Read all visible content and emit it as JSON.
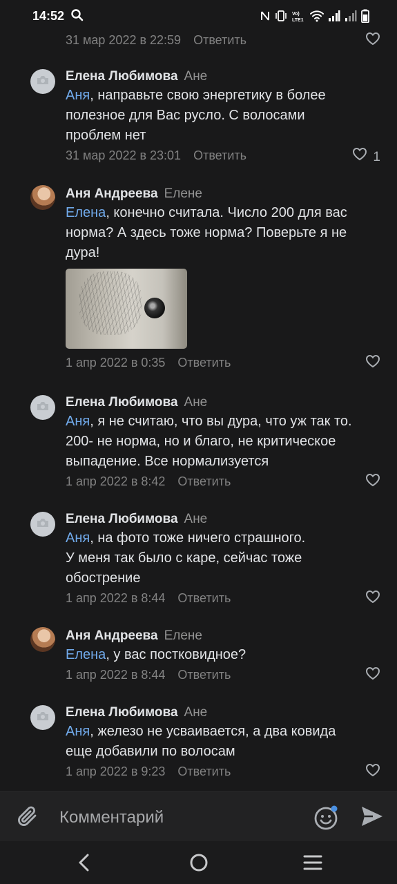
{
  "status_bar": {
    "time": "14:52",
    "icons": [
      "search-icon",
      "nfc-icon",
      "vibrate-icon",
      "volte-icon",
      "wifi-icon",
      "signal-icon",
      "signal-icon-2",
      "battery-icon"
    ]
  },
  "colors": {
    "background": "#19191a",
    "mention": "#71aaeb",
    "secondary_text": "#828282",
    "primary_text": "#e1e3e6"
  },
  "top_partial": {
    "date": "31 мар 2022 в 22:59",
    "reply_label": "Ответить"
  },
  "comments": [
    {
      "author": "Елена Любимова",
      "reply_to": "Ане",
      "mention": "Аня",
      "text": ", направьте свою энергетику в более\nполезное для Вас русло. С волосами\nпроблем нет",
      "date": "31 мар 2022 в 23:01",
      "reply_label": "Ответить",
      "likes": "1"
    },
    {
      "author": "Аня Андреева",
      "reply_to": "Елене",
      "mention": "Елена",
      "text": ", конечно считала. Число 200 для вас\nнорма? А здесь тоже норма? Поверьте я не\nдура!",
      "date": "1 апр 2022 в 0:35",
      "reply_label": "Ответить"
    },
    {
      "author": "Елена Любимова",
      "reply_to": "Ане",
      "mention": "Аня",
      "text": ", я не считаю, что вы дура, что уж так то.\n200- не норма, но и благо, не критическое\nвыпадение. Все нормализуется",
      "date": "1 апр 2022 в 8:42",
      "reply_label": "Ответить"
    },
    {
      "author": "Елена Любимова",
      "reply_to": "Ане",
      "mention": "Аня",
      "text": ", на фото тоже ничего страшного.\nУ меня так было с каре, сейчас тоже\nобострение",
      "date": "1 апр 2022 в 8:44",
      "reply_label": "Ответить"
    },
    {
      "author": "Аня Андреева",
      "reply_to": "Елене",
      "mention": "Елена",
      "text": ", у вас постковидное?",
      "date": "1 апр 2022 в 8:44",
      "reply_label": "Ответить"
    },
    {
      "author": "Елена Любимова",
      "reply_to": "Ане",
      "mention": "Аня",
      "text": ", железо не усваивается, а два ковида\nеще добавили по волосам",
      "date": "1 апр 2022 в 9:23",
      "reply_label": "Ответить"
    }
  ],
  "input": {
    "placeholder": "Комментарий"
  },
  "nav": {
    "icons": [
      "back-icon",
      "home-icon",
      "recents-icon"
    ]
  }
}
